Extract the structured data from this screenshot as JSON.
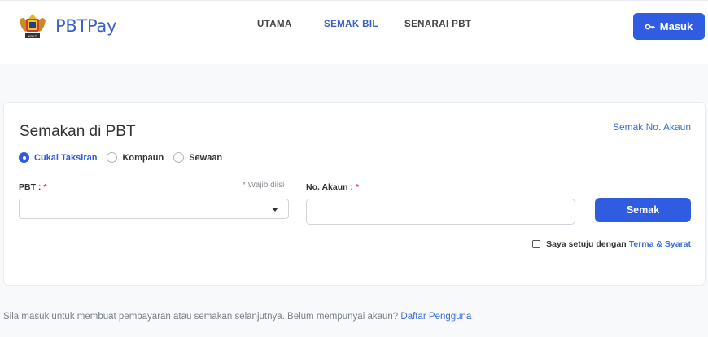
{
  "header": {
    "brand": "PBTPay",
    "nav": [
      "UTAMA",
      "SEMAK BIL",
      "SENARAI PBT"
    ],
    "active_nav": "SEMAK BIL",
    "login_label": "Masuk",
    "login_icon": "key-icon"
  },
  "card": {
    "title": "Semakan di PBT",
    "account_link": "Semak No. Akaun",
    "radio_options": [
      "Cukai Taksiran",
      "Kompaun",
      "Sewaan"
    ],
    "selected_option": "Cukai Taksiran",
    "pbt_label": "PBT :",
    "required_mark": "*",
    "required_note": "* Wajib diisi",
    "pbt_value": "",
    "account_label": "No. Akaun :",
    "account_value": "",
    "submit_label": "Semak",
    "agree_text": "Saya setuju dengan",
    "terms_link": "Terma & Syarat"
  },
  "footer": {
    "note": "Sila masuk untuk membuat pembayaran atau semakan selanjutnya. Belum mempunyai akaun?",
    "register_link": "Daftar Pengguna"
  },
  "colors": {
    "primary": "#2f5ce0",
    "link": "#3a6fd8",
    "required": "#e0454f"
  }
}
